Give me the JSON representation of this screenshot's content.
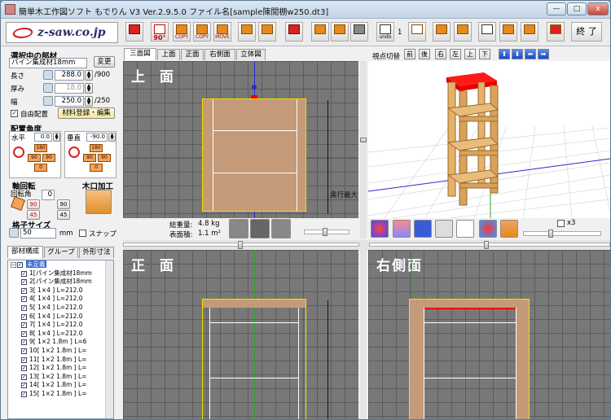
{
  "window": {
    "title": "簡単木工作図ソフト もでりん V3   Ver.2.9.5.0   ファイル名[sample陳間棚w250.dt3]",
    "min_label": "—",
    "max_label": "□",
    "close_label": "x"
  },
  "toolbar": {
    "logo_text": "z-saw.co.jp",
    "undo_label": "undo",
    "undo_count": "1",
    "exit_label": "終 了",
    "copy_labels": [
      "COPY",
      "COPY",
      "MOVE"
    ],
    "rotate_label": "90°"
  },
  "left": {
    "selected_title": "選択中の部材",
    "material_name": "パイン集成材18mm",
    "change_label": "変更",
    "length_label": "長さ",
    "length_value": "288.0",
    "length_max": "/900",
    "thickness_label": "厚み",
    "thickness_value": "18.0",
    "width_label": "幅",
    "width_value": "250.0",
    "width_max": "/250",
    "free_place_label": "自由配置",
    "material_edit_label": "材料登録・編集",
    "angle_title": "配置角度",
    "horizontal_label": "水平",
    "horizontal_value": "0.0",
    "vertical_label": "垂直",
    "vertical_value": "-90.0",
    "angle_buttons": [
      "180",
      "90",
      "90",
      "0"
    ],
    "axis_title": "軸回転",
    "axis_rot_label": "回転角",
    "axis_rot_value": "0",
    "axis_buttons": [
      "90",
      "45",
      "90",
      "45"
    ],
    "kiguchi_title": "木口加工",
    "grid_title": "格子サイズ",
    "grid_value": "50",
    "grid_unit": "mm",
    "snap_label": "スナップ",
    "tabs": [
      "部材構成",
      "グループ",
      "外形寸法"
    ],
    "tree_root": "未定義",
    "tree_items": [
      "1[パイン集成材18mm",
      "2[パイン集成材18mm",
      "3[ 1×4 ] L=212.0",
      "4[ 1×4 ] L=212.0",
      "5[ 1×4 ] L=212.0",
      "6[ 1×4 ] L=212.0",
      "7[ 1×4 ] L=212.0",
      "8[ 1×4 ] L=212.0",
      "9[ 1×2 1.8m ] L=6",
      "10[ 1×2 1.8m ] L=",
      "11[ 1×2 1.8m ] L=",
      "12[ 1×2 1.8m ] L=",
      "13[ 1×2 1.8m ] L=",
      "14[ 1×2 1.8m ] L=",
      "15[ 1×2 1.8m ] L="
    ]
  },
  "view_tabs": [
    "三面図",
    "上面",
    "正面",
    "右側面",
    "立体図"
  ],
  "top_view": {
    "title": "上 面",
    "depth_label": "奥行最大",
    "total_weight_label": "総重量:",
    "total_weight_value": "4.8 kg",
    "surface_area_label": "表面積:",
    "surface_area_value": "1.1 m²"
  },
  "view3d": {
    "viewpoint_label": "視点切替",
    "buttons": [
      "前",
      "後",
      "右",
      "左",
      "上",
      "下"
    ],
    "x3_label": "x3"
  },
  "front_view": {
    "title": "正 面"
  },
  "side_view": {
    "title": "右側面"
  },
  "colors": {
    "accent_red": "#e00000",
    "wood": "#e7b16a",
    "highlight_yellow": "#f0e000"
  }
}
